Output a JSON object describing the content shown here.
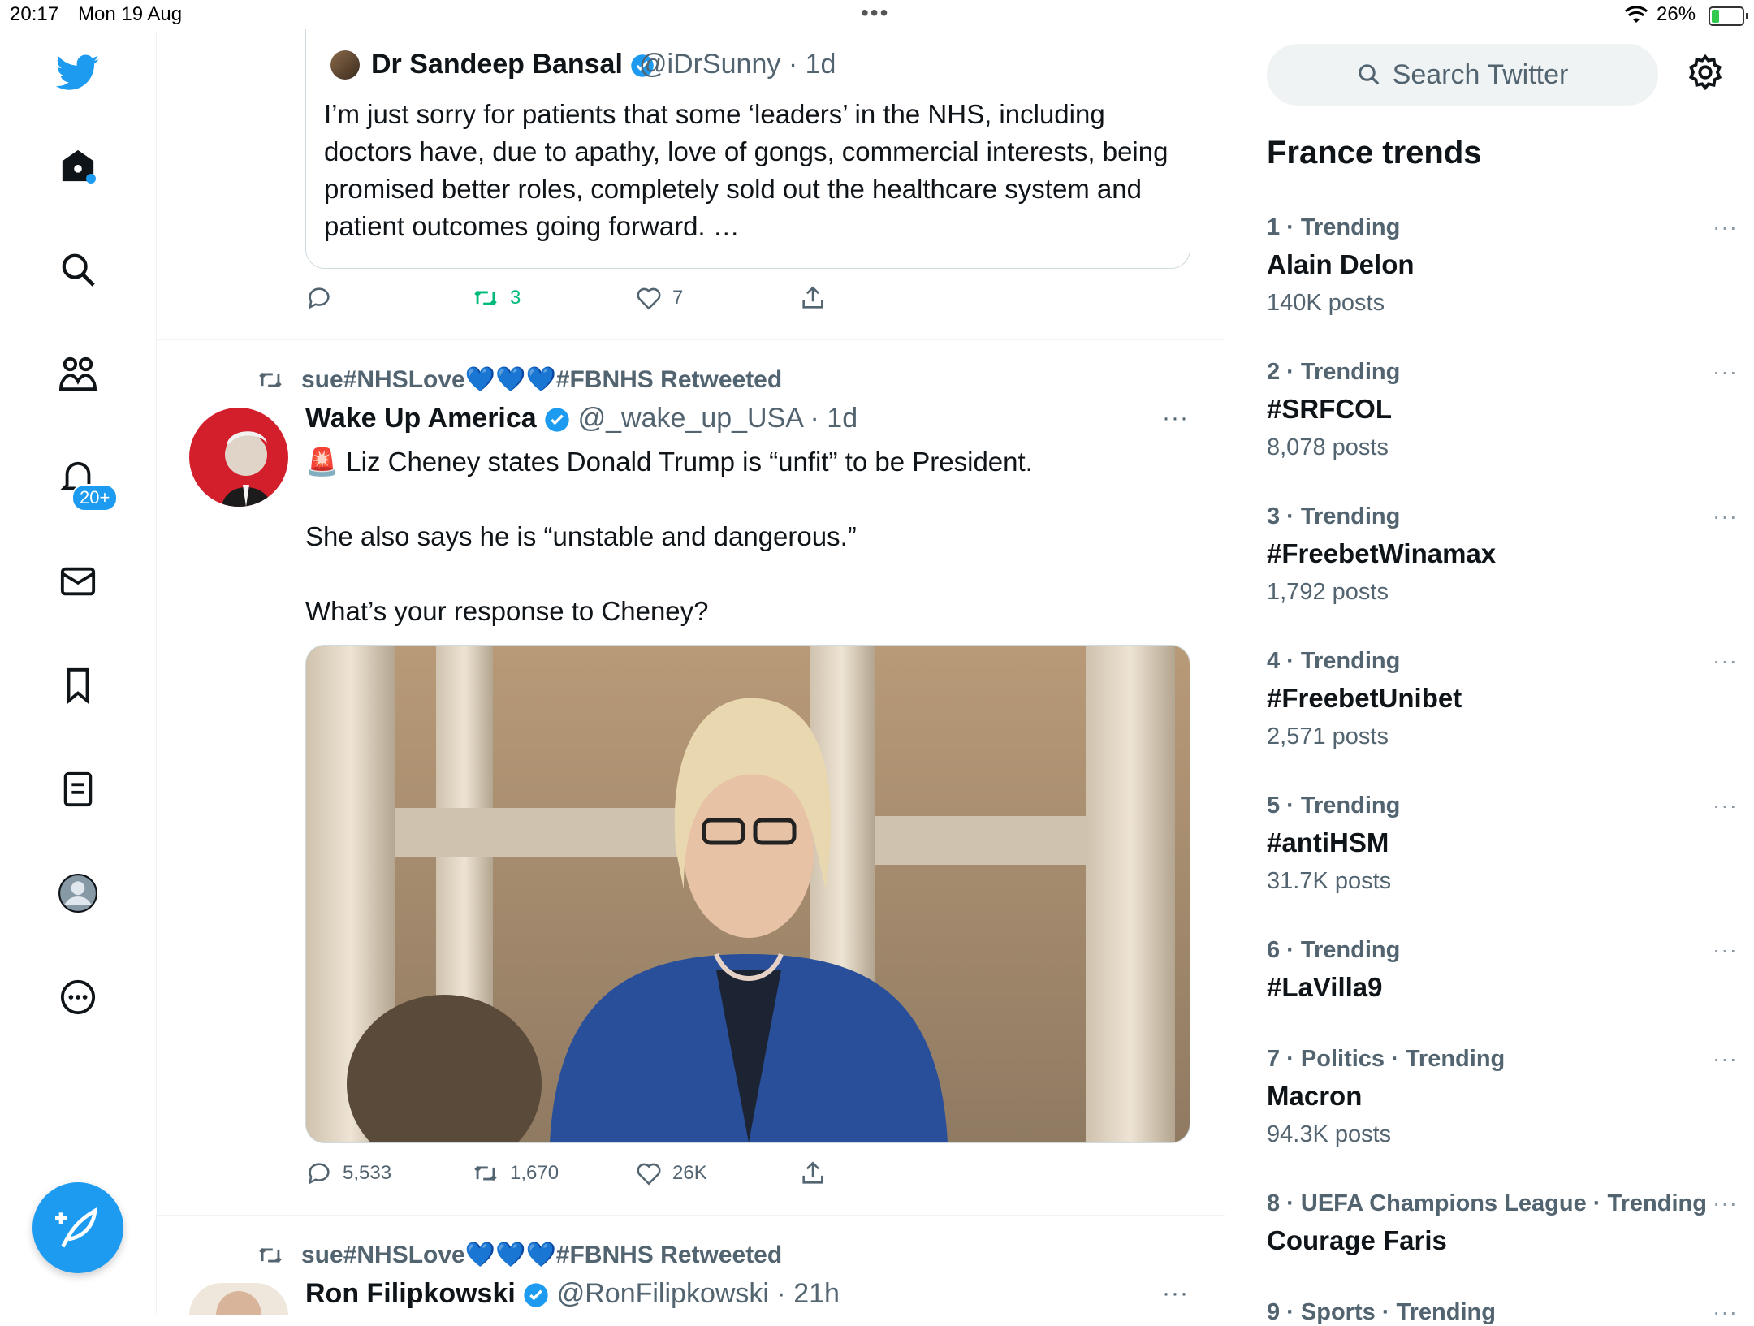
{
  "status_bar": {
    "time": "20:17",
    "date": "Mon 19 Aug",
    "dots": "•••",
    "battery_pct": "26%",
    "battery_level": 0.26
  },
  "rail": {
    "icons": [
      "twitter-bird-icon",
      "home-icon",
      "search-icon",
      "communities-icon",
      "notifications-icon",
      "messages-icon",
      "bookmarks-icon",
      "lists-icon",
      "profile-icon",
      "more-icon"
    ],
    "notifications_badge": "20+"
  },
  "quote_tweet": {
    "name": "Dr Sandeep Bansal",
    "handle": "@iDrSunny",
    "age": "· 1d",
    "text": "I’m just sorry for patients that some ‘leaders’ in the NHS, including doctors have, due to apathy, love of gongs, commercial interests, being promised better roles, completely sold out the healthcare system and patient outcomes going forward. …",
    "retweets": "3",
    "likes": "7"
  },
  "tweet1": {
    "retweeted_by": "sue#NHSLove💙💙💙#FBNHS Retweeted",
    "name": "Wake Up America",
    "handle": "@_wake_up_USA",
    "age": "· 1d",
    "text": "🚨 Liz Cheney states Donald Trump is “unfit” to be President.\n\nShe also says he is “unstable and dangerous.”\n\nWhat’s your response to Cheney?",
    "replies": "5,533",
    "retweets": "1,670",
    "likes": "26K"
  },
  "tweet2": {
    "retweeted_by": "sue#NHSLove💙💙💙#FBNHS Retweeted",
    "name": "Ron Filipkowski",
    "handle": "@RonFilipkowski",
    "age": "· 21h"
  },
  "sidebar": {
    "search_placeholder": "Search Twitter",
    "trends_title": "France trends",
    "trends": [
      {
        "meta": "1 · Trending",
        "name": "Alain Delon",
        "count": "140K posts"
      },
      {
        "meta": "2 · Trending",
        "name": "#SRFCOL",
        "count": "8,078 posts"
      },
      {
        "meta": "3 · Trending",
        "name": "#FreebetWinamax",
        "count": "1,792 posts"
      },
      {
        "meta": "4 · Trending",
        "name": "#FreebetUnibet",
        "count": "2,571 posts"
      },
      {
        "meta": "5 · Trending",
        "name": "#antiHSM",
        "count": "31.7K posts"
      },
      {
        "meta": "6 · Trending",
        "name": "#LaVilla9",
        "count": ""
      },
      {
        "meta": "7 · Politics · Trending",
        "name": "Macron",
        "count": "94.3K posts"
      },
      {
        "meta": "8 · UEFA Champions League · Trending",
        "name": "Courage Faris",
        "count": ""
      },
      {
        "meta": "9 · Sports · Trending",
        "name": "",
        "count": ""
      }
    ],
    "more_label": "···"
  },
  "colors": {
    "accent": "#1d9bf0",
    "retweet_green": "#00ba7c",
    "muted": "#536471"
  }
}
